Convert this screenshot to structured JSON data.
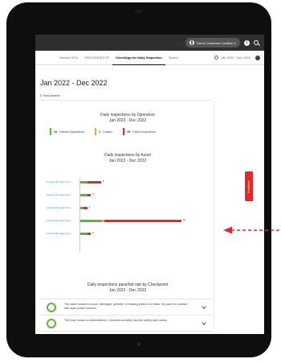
{
  "topbar": {
    "location": "Demo Customer Location 1",
    "info_icon": "info-icon",
    "search_icon": "search-icon"
  },
  "tabs": [
    {
      "label": "Service KPIs",
      "active": false
    },
    {
      "label": "TRUCONNECT®",
      "active": false
    },
    {
      "label": "CheckApp for Daily Inspection",
      "active": true
    },
    {
      "label": "Spend",
      "active": false
    }
  ],
  "date_range": "Jan 2022 - Dec 2022",
  "page": {
    "title": "Jan 2022 - Dec 2022",
    "total_assets": "5 Total Assets"
  },
  "operators_section": {
    "title": "Daily inspections by Operators",
    "subtitle": "Jan 2022 - Dec 2022",
    "legend": [
      {
        "count": "13",
        "label": "Passed inspections",
        "color": "#5cb82e"
      },
      {
        "count": "1",
        "label": "Caution",
        "color": "#f5a623"
      },
      {
        "count": "29",
        "label": "Failed inspections",
        "color": "#e02a2a"
      }
    ]
  },
  "asset_section": {
    "title": "Daily inspections by Asset",
    "subtitle": "Jan 2022 - Dec 2022"
  },
  "chart_data": {
    "type": "bar",
    "orientation": "horizontal",
    "stacked": true,
    "categories": [
      "Crane 1 (Kongle 3 ton)",
      "Crane 2 (Kongle 3 ton)",
      "Crane 3 (Kongle 3 ton)",
      "Crane 4 (Kongle 3 ton)",
      "Crane 5 (Kongle 3 ton)"
    ],
    "series": [
      {
        "name": "Passed inspections",
        "color": "#5cb82e",
        "values": [
          2,
          2,
          1,
          6,
          2
        ]
      },
      {
        "name": "Caution",
        "color": "#f5a623",
        "values": [
          0,
          0,
          0,
          1,
          0
        ]
      },
      {
        "name": "Failed inspections",
        "color": "#e02a2a",
        "values": [
          4,
          1,
          1,
          22,
          1
        ]
      }
    ],
    "totals": [
      "6",
      "3",
      "2",
      "29",
      "3"
    ],
    "xlim": [
      0,
      30
    ]
  },
  "checkpoint_section": {
    "title": "Daily inspections pass/fail rate by Checkpoint",
    "subtitle": "Jan 2022 - Dec 2022",
    "items": [
      {
        "text": "The crane shows no loose, damaged, jammed, or missing parts or oil leaks. No part is in contact with open power sources."
      },
      {
        "text": "The hook shows no deformations, it swivels smoothly, and the safety latch works."
      }
    ]
  },
  "feedback": {
    "label": "Feedback"
  }
}
